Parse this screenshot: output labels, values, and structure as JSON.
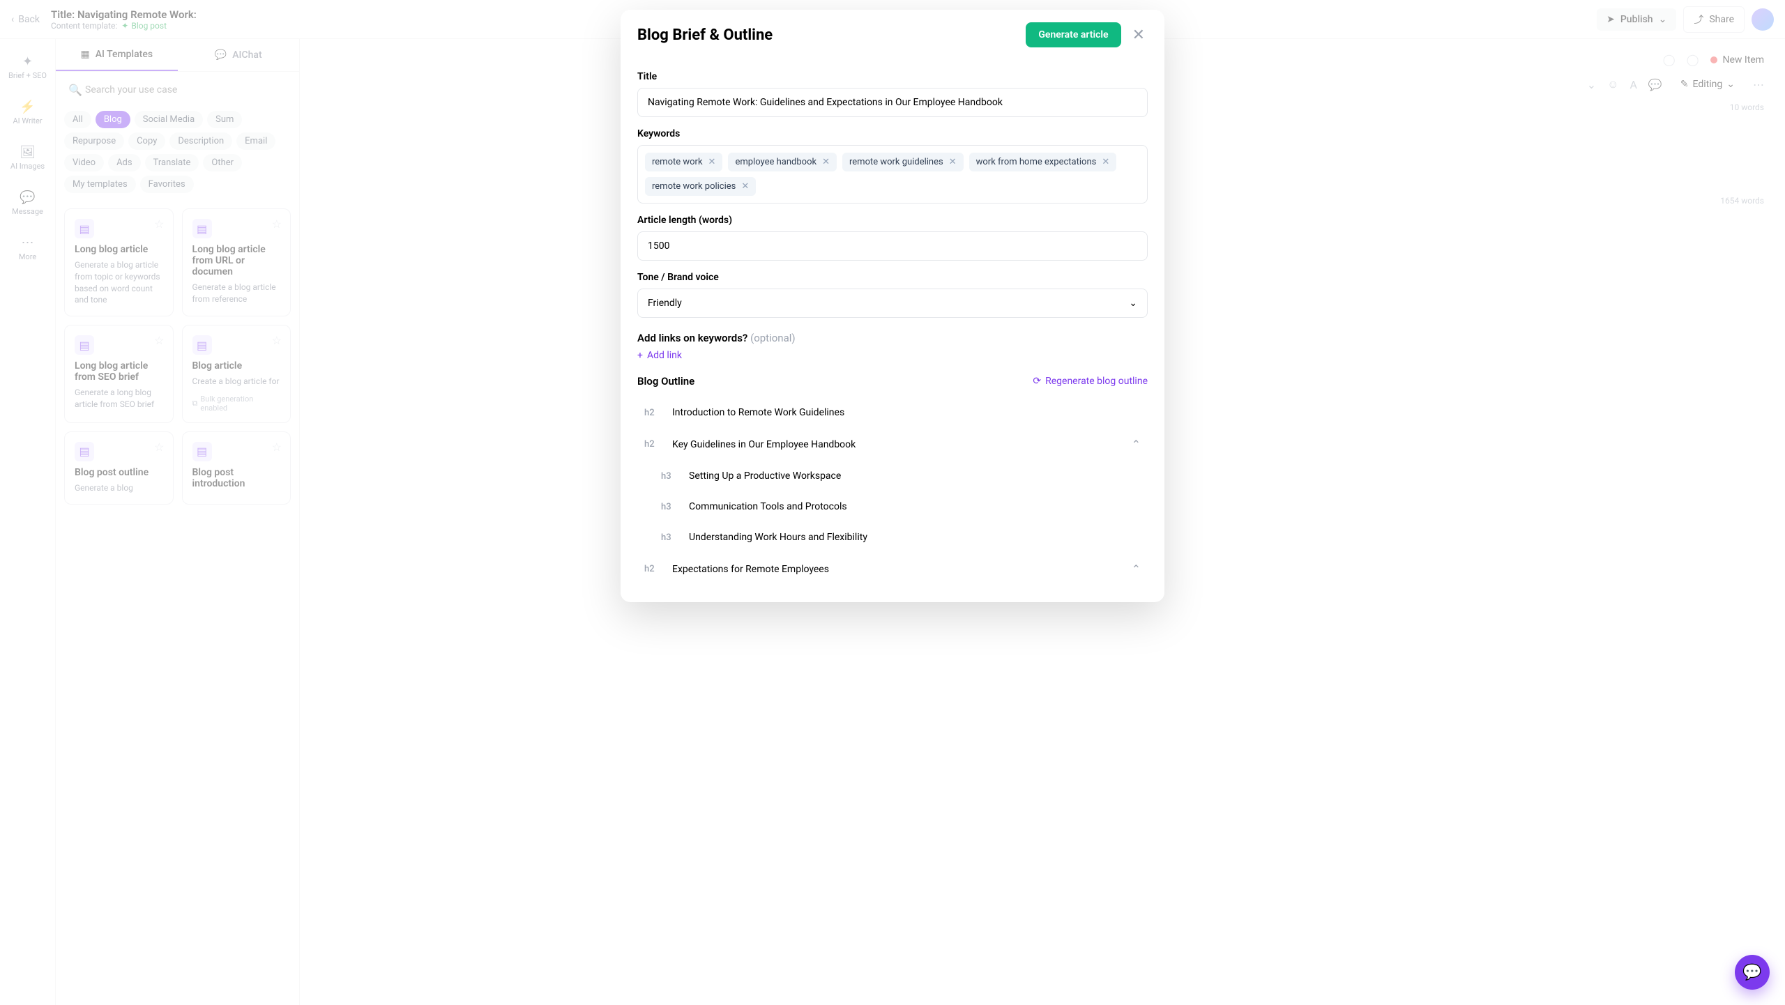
{
  "header": {
    "back": "Back",
    "title_prefix": "Title:",
    "title": "Navigating Remote Work:",
    "subtitle_label": "Content template:",
    "template_name": "Blog post",
    "publish": "Publish",
    "share": "Share"
  },
  "rail": {
    "brief": "Brief + SEO",
    "writer": "AI Writer",
    "images": "AI Images",
    "message": "Message",
    "more": "More"
  },
  "sidebar": {
    "tab_templates": "AI Templates",
    "tab_aichat": "AIChat",
    "search_placeholder": "Search your use case",
    "pills": [
      "All",
      "Blog",
      "Social Media",
      "Sum",
      "Repurpose",
      "Copy",
      "Description",
      "Email",
      "Video",
      "Ads",
      "Translate",
      "Other",
      "My templates",
      "Favorites"
    ],
    "active_pill": "Blog",
    "cards": [
      {
        "title": "Long blog article",
        "desc": "Generate a blog article from topic or keywords based on word count and tone"
      },
      {
        "title": "Long blog article from URL or documen",
        "desc": "Generate a blog article from reference"
      },
      {
        "title": "Long blog article from SEO brief",
        "desc": "Generate a long blog article from SEO brief"
      },
      {
        "title": "Blog article",
        "desc": "Create a blog article for",
        "foot": "Bulk generation enabled"
      },
      {
        "title": "Blog post outline",
        "desc": "Generate a blog"
      },
      {
        "title": "Blog post introduction",
        "desc": ""
      }
    ]
  },
  "toolbar": {
    "new_item": "New Item",
    "editing": "Editing",
    "words_top": "10 words",
    "words_main": "1654 words"
  },
  "modal": {
    "title": "Blog Brief & Outline",
    "generate": "Generate article",
    "label_title": "Title",
    "value_title": "Navigating Remote Work: Guidelines and Expectations in Our Employee Handbook",
    "label_keywords": "Keywords",
    "keywords": [
      "remote work",
      "employee handbook",
      "remote work guidelines",
      "work from home expectations",
      "remote work policies"
    ],
    "label_length": "Article length (words)",
    "value_length": "1500",
    "label_tone": "Tone / Brand voice",
    "value_tone": "Friendly",
    "label_links": "Add links on keywords?",
    "links_optional": "(optional)",
    "add_link": "Add link",
    "outline_title": "Blog Outline",
    "regenerate": "Regenerate blog outline",
    "outline": [
      {
        "level": "h2",
        "text": "Introduction to Remote Work Guidelines",
        "expand": false
      },
      {
        "level": "h2",
        "text": "Key Guidelines in Our Employee Handbook",
        "expand": true
      },
      {
        "level": "h3",
        "text": "Setting Up a Productive Workspace",
        "expand": false
      },
      {
        "level": "h3",
        "text": "Communication Tools and Protocols",
        "expand": false
      },
      {
        "level": "h3",
        "text": "Understanding Work Hours and Flexibility",
        "expand": false
      },
      {
        "level": "h2",
        "text": "Expectations for Remote Employees",
        "expand": true
      }
    ]
  }
}
